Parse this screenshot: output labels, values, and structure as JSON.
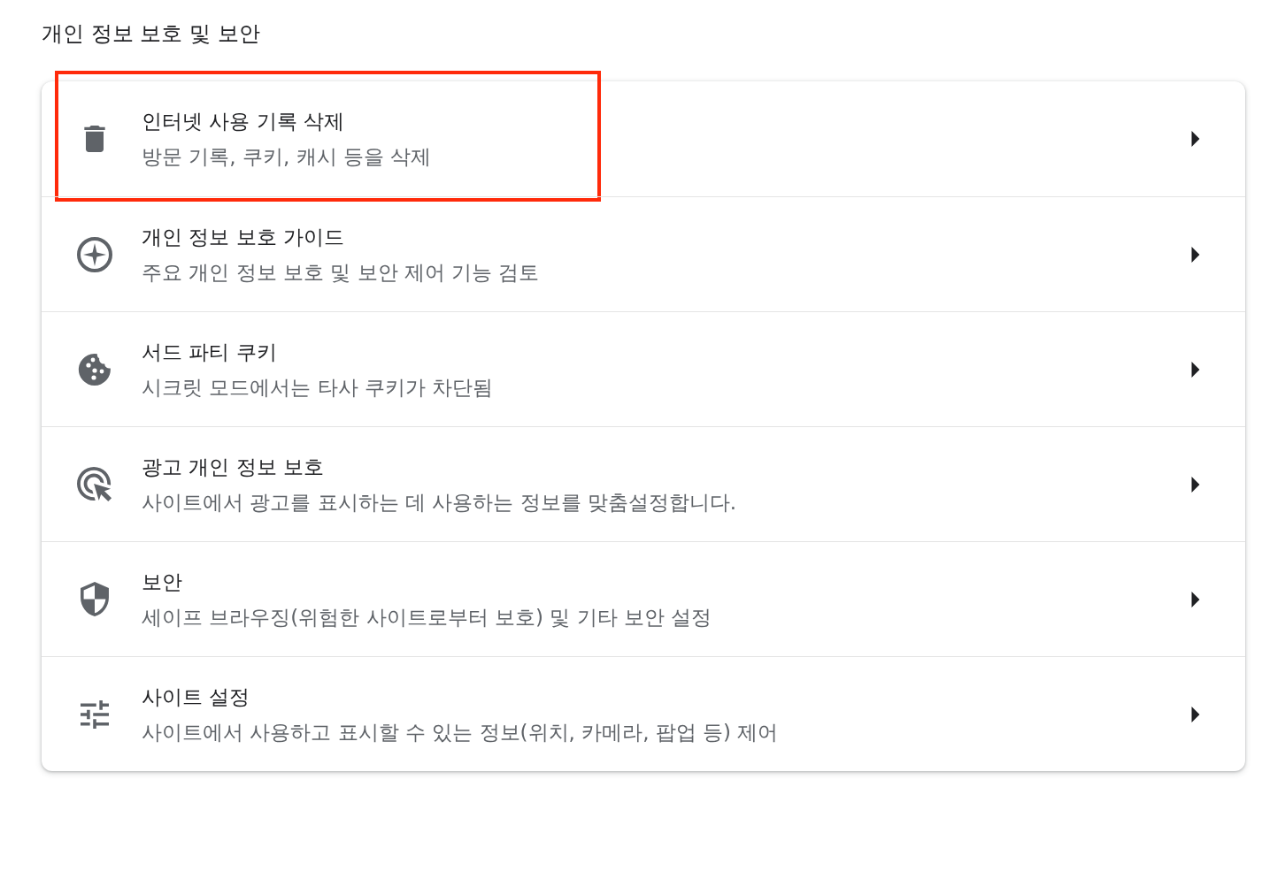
{
  "section_title": "개인 정보 보호 및 보안",
  "items": [
    {
      "title": "인터넷 사용 기록 삭제",
      "subtitle": "방문 기록, 쿠키, 캐시 등을 삭제",
      "highlighted": true
    },
    {
      "title": "개인 정보 보호 가이드",
      "subtitle": "주요 개인 정보 보호 및 보안 제어 기능 검토",
      "highlighted": false
    },
    {
      "title": "서드 파티 쿠키",
      "subtitle": "시크릿 모드에서는 타사 쿠키가 차단됨",
      "highlighted": false
    },
    {
      "title": "광고 개인 정보 보호",
      "subtitle": "사이트에서 광고를 표시하는 데 사용하는 정보를 맞춤설정합니다.",
      "highlighted": false
    },
    {
      "title": "보안",
      "subtitle": "세이프 브라우징(위험한 사이트로부터 보호) 및 기타 보안 설정",
      "highlighted": false
    },
    {
      "title": "사이트 설정",
      "subtitle": "사이트에서 사용하고 표시할 수 있는 정보(위치, 카메라, 팝업 등) 제어",
      "highlighted": false
    }
  ]
}
